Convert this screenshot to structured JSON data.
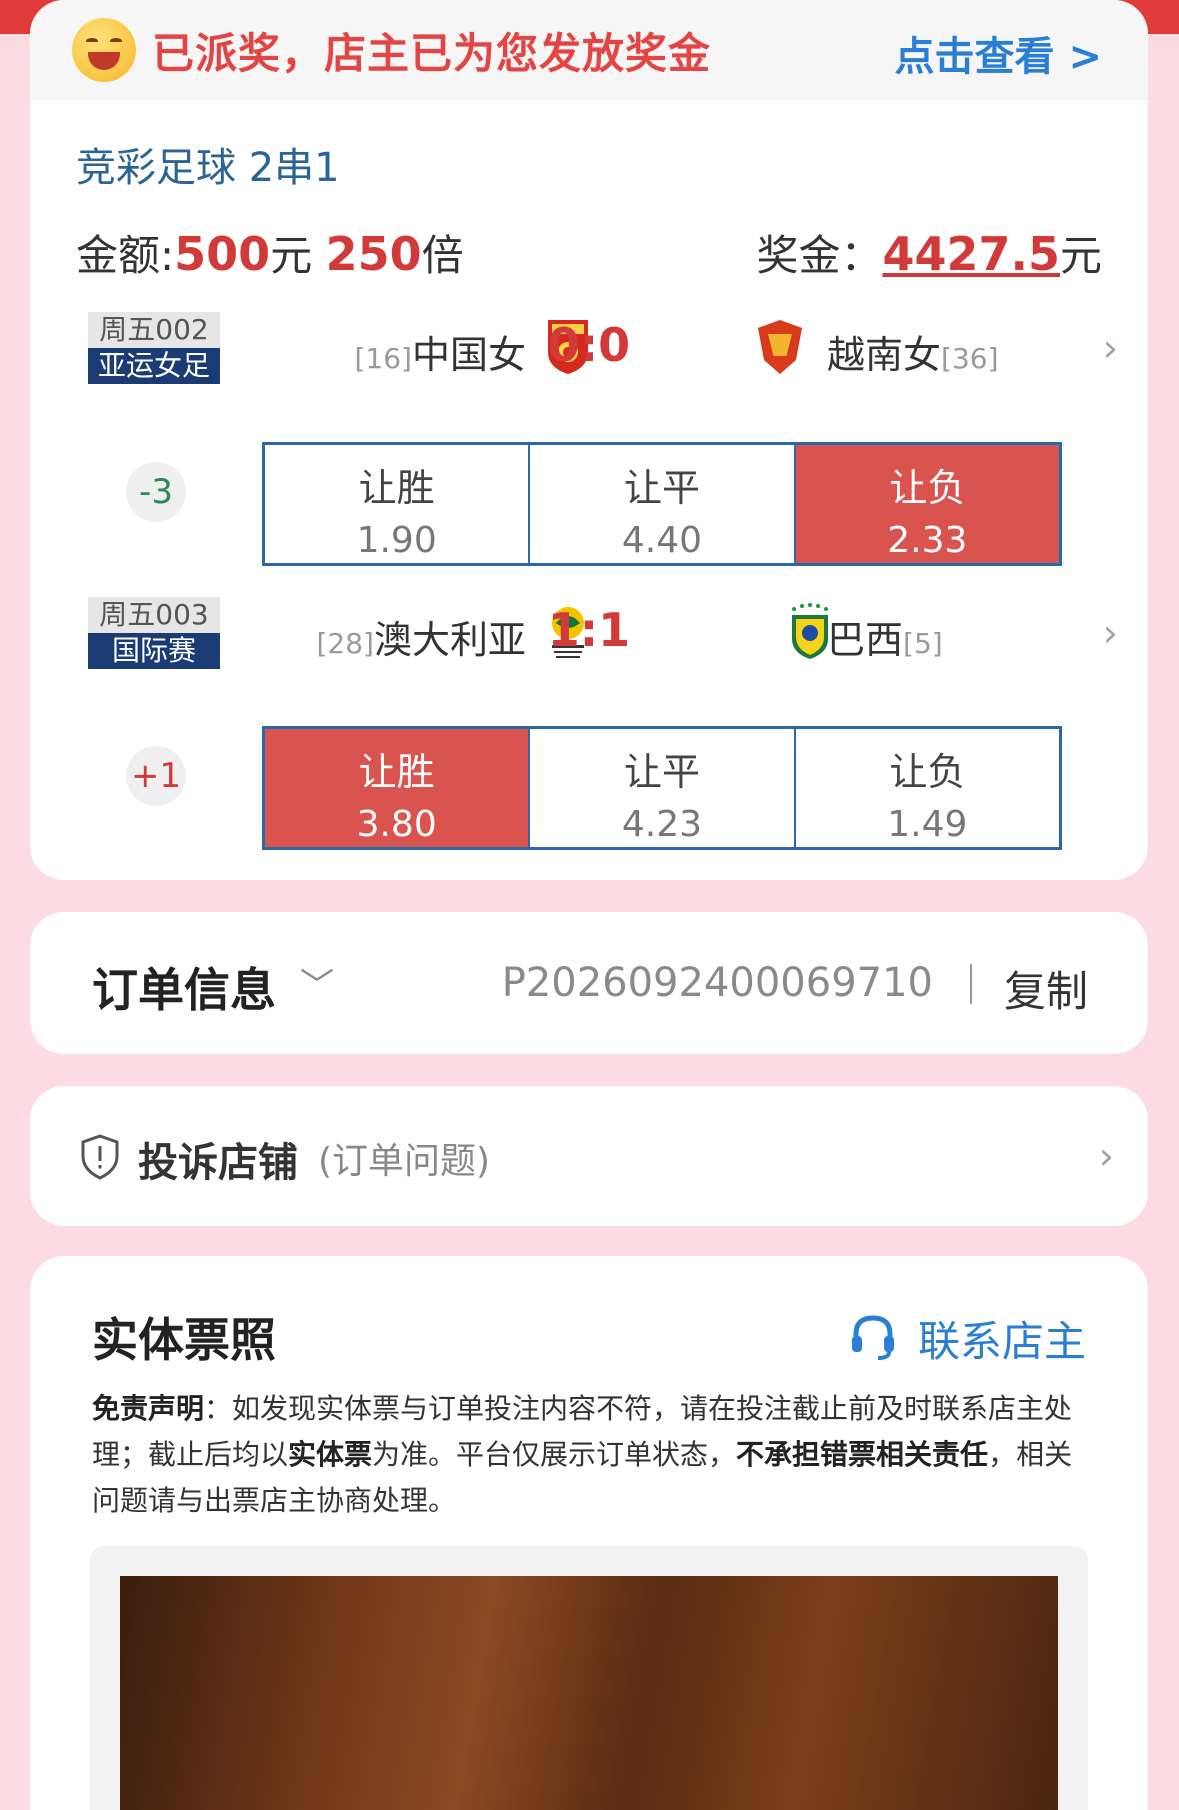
{
  "banner": {
    "text": "已派奖，店主已为您发放奖金",
    "link": "点击查看 >"
  },
  "bet": {
    "title": "竞彩足球 2串1",
    "amount_label": "金额:",
    "amount_value": "500",
    "amount_unit": "元",
    "multiple_value": "250",
    "multiple_unit": "倍",
    "prize_label": "奖金：",
    "prize_value": "4427.5",
    "prize_unit": "元"
  },
  "matches": [
    {
      "number": "周五002",
      "league": "亚运女足",
      "home_rank": "[16]",
      "home": "中国女",
      "score": "0:0",
      "away": "越南女",
      "away_rank": "[36]",
      "handicap": "-3",
      "odds": [
        {
          "label": "让胜",
          "value": "1.90",
          "selected": false
        },
        {
          "label": "让平",
          "value": "4.40",
          "selected": false
        },
        {
          "label": "让负",
          "value": "2.33",
          "selected": true
        }
      ]
    },
    {
      "number": "周五003",
      "league": "国际赛",
      "home_rank": "[28]",
      "home": "澳大利亚",
      "score": "1:1",
      "away": "巴西",
      "away_rank": "[5]",
      "handicap": "+1",
      "odds": [
        {
          "label": "让胜",
          "value": "3.80",
          "selected": true
        },
        {
          "label": "让平",
          "value": "4.23",
          "selected": false
        },
        {
          "label": "让负",
          "value": "1.49",
          "selected": false
        }
      ]
    }
  ],
  "order": {
    "title": "订单信息",
    "number": "P2026092400069710",
    "copy": "复制"
  },
  "complaint": {
    "title": "投诉店铺",
    "sub": "(订单问题)"
  },
  "ticket": {
    "title": "实体票照",
    "contact": "联系店主",
    "d1": "免责声明",
    "d2": "：如发现实体票与订单投注内容不符，请在投注截止前及时联系店主处理；截止后均以",
    "d3": "实体票",
    "d4": "为准。平台仅展示订单状态，",
    "d5": "不承担错票相关责任",
    "d6": "，相关问题请与出票店主协商处理。"
  },
  "colors": {
    "accent_red": "#d23a3a",
    "accent_blue": "#2a7fd4",
    "page_bg": "#fcdbe2"
  }
}
